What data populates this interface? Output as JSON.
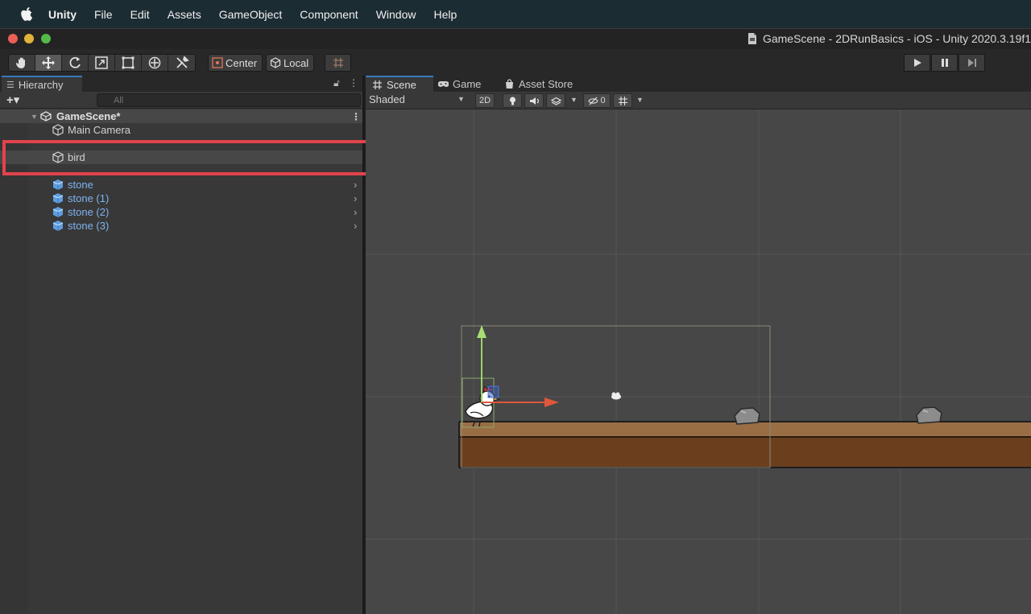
{
  "menubar": {
    "apple_icon": "apple-logo-icon",
    "items": [
      "Unity",
      "File",
      "Edit",
      "Assets",
      "GameObject",
      "Component",
      "Window",
      "Help"
    ]
  },
  "window": {
    "title": "GameScene - 2DRunBasics - iOS - Unity 2020.3.19f1"
  },
  "toolbar": {
    "tools": [
      "hand-tool-icon",
      "move-tool-icon",
      "rotate-tool-icon",
      "scale-tool-icon",
      "rect-tool-icon",
      "transform-tool-icon",
      "custom-tool-icon"
    ],
    "active_tool": "move-tool-icon",
    "pivot_label": "Center",
    "space_label": "Local",
    "play": [
      "play-icon",
      "pause-icon",
      "step-icon"
    ]
  },
  "hierarchy": {
    "tab_label": "Hierarchy",
    "search_placeholder": "All",
    "add_label": "+▾",
    "scene_name": "GameScene*",
    "items": [
      {
        "label": "Main Camera",
        "prefab": false
      },
      {
        "label": "bird",
        "prefab": false
      },
      {
        "label": "stone",
        "prefab": true
      },
      {
        "label": "stone (1)",
        "prefab": true
      },
      {
        "label": "stone (2)",
        "prefab": true
      },
      {
        "label": "stone (3)",
        "prefab": true
      }
    ]
  },
  "scene": {
    "tabs": [
      "Scene",
      "Game",
      "Asset Store"
    ],
    "active_tab": "Scene",
    "shading_mode": "Shaded",
    "mode_2d": "2D",
    "hidden_count": "0"
  },
  "colors": {
    "highlight": "#e2434b",
    "accent": "#3a79bb",
    "prefab_text": "#7fb4ef",
    "ground_top": "#9a6e45",
    "ground_body": "#6b3f1e"
  }
}
